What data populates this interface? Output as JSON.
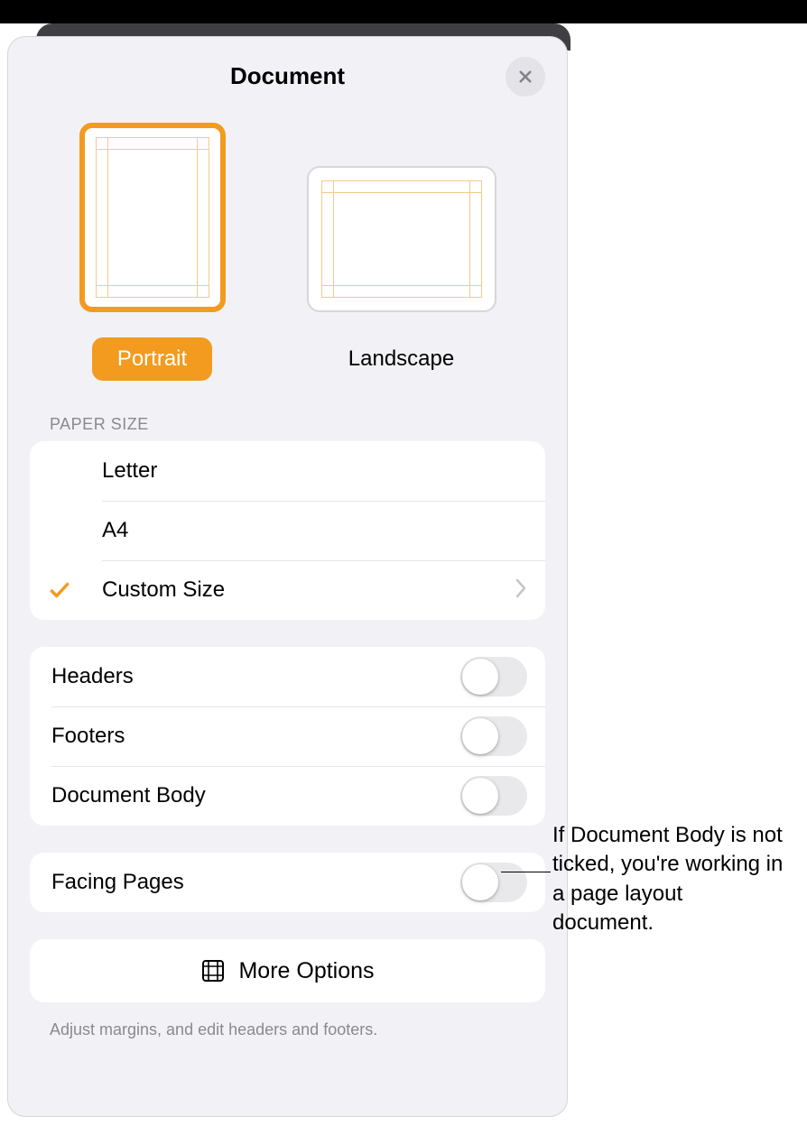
{
  "header": {
    "title": "Document"
  },
  "orientation": {
    "portrait_label": "Portrait",
    "landscape_label": "Landscape",
    "selected": "portrait"
  },
  "paper_size": {
    "section_label": "PAPER SIZE",
    "options": [
      {
        "label": "Letter",
        "selected": false,
        "disclosure": false
      },
      {
        "label": "A4",
        "selected": false,
        "disclosure": false
      },
      {
        "label": "Custom Size",
        "selected": true,
        "disclosure": true
      }
    ]
  },
  "toggles_group1": [
    {
      "label": "Headers",
      "on": false
    },
    {
      "label": "Footers",
      "on": false
    },
    {
      "label": "Document Body",
      "on": false
    }
  ],
  "toggles_group2": [
    {
      "label": "Facing Pages",
      "on": false
    }
  ],
  "more_options": {
    "label": "More Options"
  },
  "footer_hint": "Adjust margins, and edit headers and footers.",
  "callout_text": "If Document Body is not ticked, you're working in a page layout document.",
  "colors": {
    "accent": "#f39b1f"
  }
}
